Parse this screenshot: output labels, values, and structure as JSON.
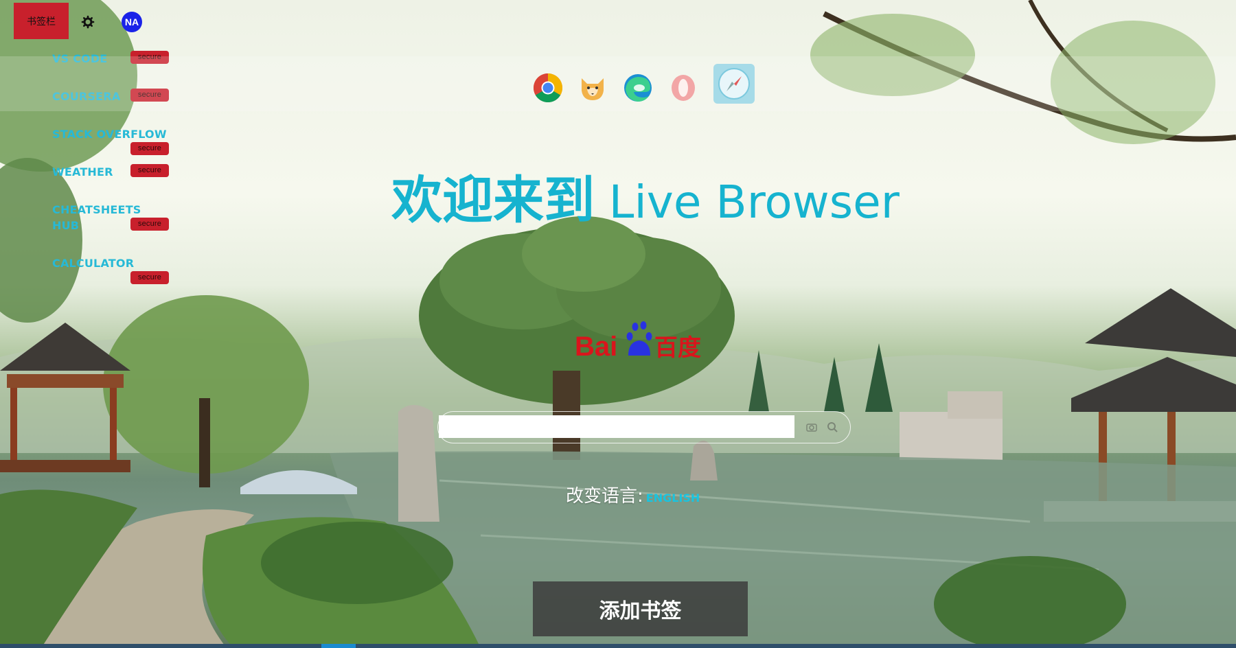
{
  "topbar": {
    "bookmark_bar_label": "书签栏",
    "avatar_text": "NA"
  },
  "bookmarks": [
    {
      "label": "VS CODE",
      "badge": "secure"
    },
    {
      "label": "COURSERA",
      "badge": "secure"
    },
    {
      "label": "STACK OVERFLOW",
      "badge": "secure"
    },
    {
      "label": "WEATHER",
      "badge": "secure"
    },
    {
      "label": "CHEATSHEETS HUB",
      "badge": "secure"
    },
    {
      "label": "CALCULATOR",
      "badge": "secure"
    }
  ],
  "browsers": [
    "chrome-icon",
    "firefox-icon",
    "edge-icon",
    "opera-icon",
    "safari-icon"
  ],
  "title": {
    "cn": "欢迎来到",
    "en": "Live Browser"
  },
  "search": {
    "logo": "Bai百度",
    "value": "",
    "placeholder": ""
  },
  "language": {
    "label": "改变语言:",
    "link": "ENGLISH"
  },
  "actions": {
    "add_bookmark_label": "添加书签"
  },
  "colors": {
    "accent": "#16b3cf",
    "badge": "#c8202c",
    "avatar": "#1a22e8"
  }
}
